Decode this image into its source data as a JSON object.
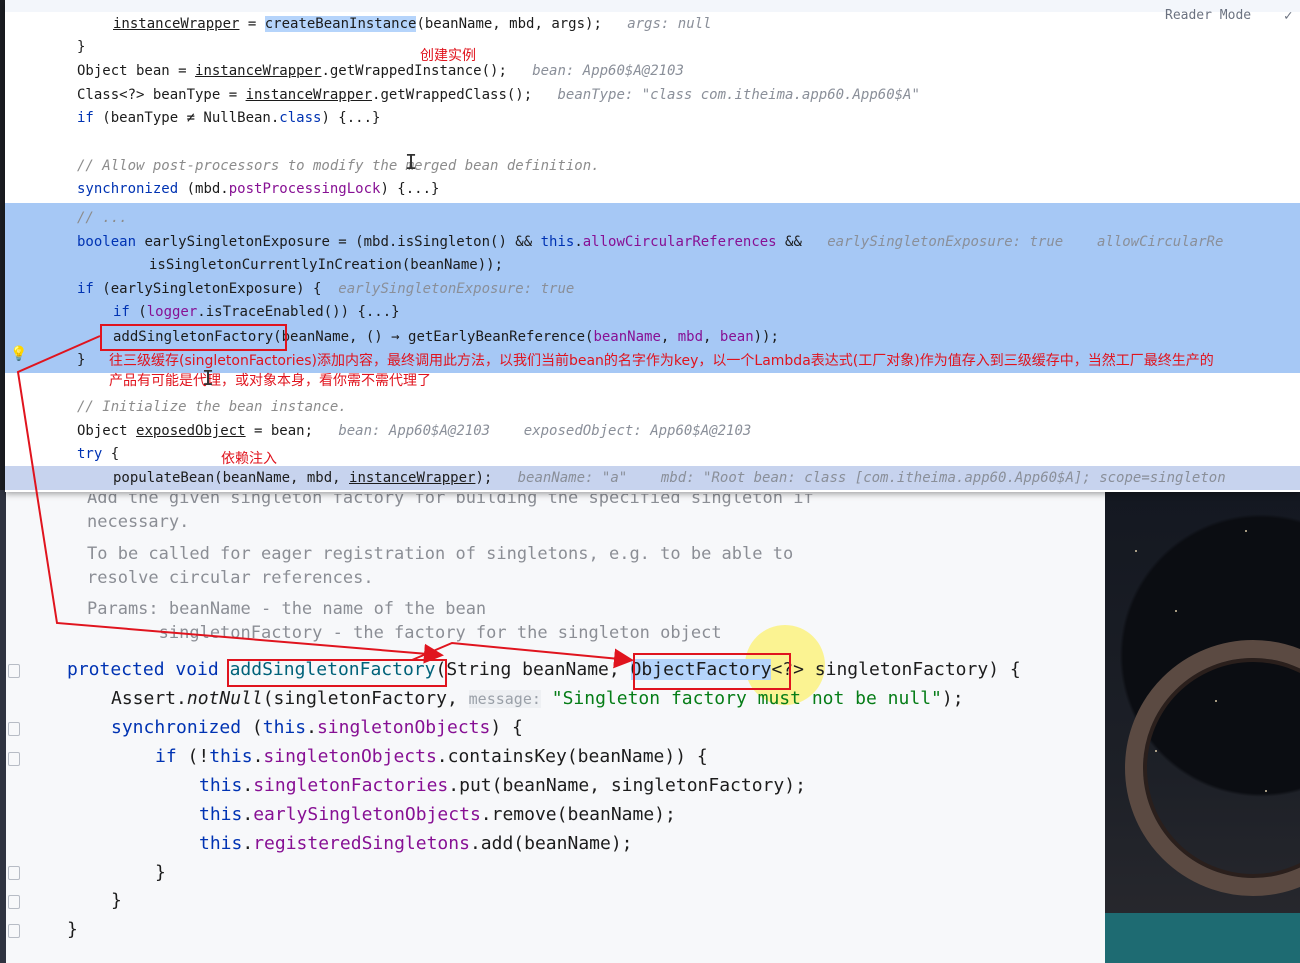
{
  "reader_mode": "Reader Mode",
  "top_code": {
    "line_wrapper": {
      "a": "instanceWrapper",
      "b": " = ",
      "c": "createBeanInstance",
      "d": "(beanName, mbd, args);",
      "hint": "args: null"
    },
    "line_brace": "}",
    "line_bean": {
      "a": "Object bean = ",
      "b": "instanceWrapper",
      "c": ".getWrappedInstance();",
      "hint": "bean: App60$A@2103"
    },
    "line_type": {
      "a": "Class<?> beanType = ",
      "b": "instanceWrapper",
      "c": ".getWrappedClass();",
      "hint": "beanType: \"class com.itheima.app60.App60$A\""
    },
    "line_if": {
      "kw": "if",
      "rest": " (beanType ≠ NullBean.",
      "kw2": "class",
      "tail": ") {...}"
    },
    "line_comment_allow": "// Allow post-processors to modify the merged bean definition.",
    "line_sync": {
      "kw": "synchronized",
      "a": " (mbd.",
      "b": "postProcessingLock",
      "c": ") {...}"
    },
    "line_dots": "// ...",
    "line_boolean": {
      "kw": "boolean",
      "a": " earlySingletonExposure = (mbd.isSingleton() && ",
      "kw2": "this",
      "b": ".",
      "c": "allowCircularReferences",
      "d": " &&",
      "hint": "earlySingletonExposure: true",
      "hint2": "allowCircularRe"
    },
    "line_iscreation": "isSingletonCurrentlyInCreation(beanName));",
    "line_if_early": {
      "kw": "if",
      "a": " (earlySingletonExposure) {",
      "hint": "earlySingletonExposure: true"
    },
    "line_trace": {
      "kw": "if",
      "a": " (",
      "b": "logger",
      "c": ".isTraceEnabled()) {...}"
    },
    "line_add": {
      "a": "addSingletonFactory",
      "b": "(beanName, () → getEarlyBeanReference(",
      "c": "beanName",
      "d": ", ",
      "e": "mbd",
      "f": ", ",
      "g": "bean",
      "h": "));"
    },
    "line_close": "}",
    "line_comment_init": "// Initialize the bean instance.",
    "line_exposed": {
      "a": "Object ",
      "b": "exposedObject",
      "c": " = bean;",
      "hint": "bean: App60$A@2103",
      "hint2": "exposedObject: App60$A@2103"
    },
    "line_try": {
      "kw": "try",
      "a": " {"
    },
    "line_populate": {
      "a": "populateBean(beanName, mbd, ",
      "b": "instanceWrapper",
      "c": ");",
      "hint": "beanName: \"a\"",
      "hint2": "mbd: \"Root bean: class [com.itheima.app60.App60$A]; scope=singleton"
    }
  },
  "annotations": {
    "create_instance": "创建实例",
    "note_line1": "往三级缓存(singletonFactories)添加内容，最终调用此方法，以我们当前bean的名字作为key，以一个Lambda表达式(工厂对象)作为值存入到三级缓存中，当然工厂最终生产的",
    "note_line2": "产品有可能是代理，或对象本身，看你需不需代理了",
    "dependency_injection": "依赖注入"
  },
  "doc": {
    "cut": "Add the given singleton factory for building the specified singleton if",
    "necessary": "necessary.",
    "called1": "To be called for eager registration of singletons, e.g. to be able to",
    "called2": "resolve circular references.",
    "params1": "Params: beanName - the name of the bean",
    "params2": "       singletonFactory - the factory for the singleton object"
  },
  "bottom_code": {
    "sig": {
      "kw1": "protected",
      "kw2": " void ",
      "name": "addSingletonFactory",
      "a": "(String beanName, ",
      "type": "ObjectFactory",
      "b": "<?> singletonFactory) {"
    },
    "assert": {
      "a": "Assert.",
      "b": "notNull",
      "c": "(singletonFactory,",
      "param": "message:",
      "str": "\"Singleton factory must not be null\"",
      "d": ");"
    },
    "sync": {
      "kw": "synchronized",
      "a": " (",
      "kw2": "this",
      "b": ".",
      "c": "singletonObjects",
      "d": ") {"
    },
    "if": {
      "kw": "if",
      "a": " (!",
      "kw2": "this",
      "b": ".",
      "c": "singletonObjects",
      "d": ".containsKey(beanName)) {"
    },
    "put": {
      "kw": "this",
      "a": ".",
      "b": "singletonFactories",
      "c": ".put(beanName, singletonFactory);"
    },
    "remove": {
      "kw": "this",
      "a": ".",
      "b": "earlySingletonObjects",
      "c": ".remove(beanName);"
    },
    "add": {
      "kw": "this",
      "a": ".",
      "b": "registeredSingletons",
      "c": ".add(beanName);"
    },
    "close1": "}",
    "close2": "}",
    "close3": "}"
  },
  "colors": {
    "selection": "#a6c8f5",
    "annotation": "#e0141e",
    "keyword": "#0033b3",
    "field": "#871094"
  }
}
